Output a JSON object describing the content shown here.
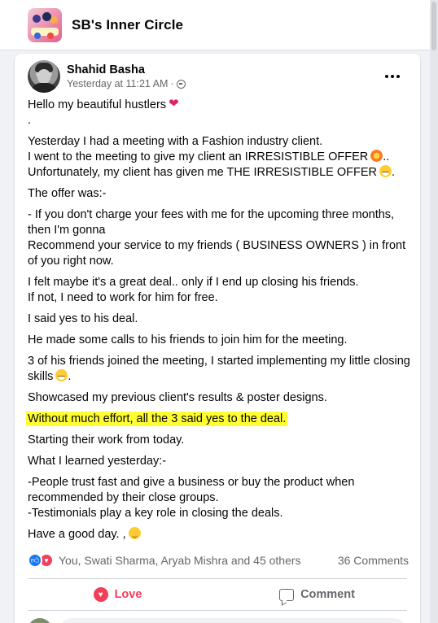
{
  "group": {
    "title": "SB's Inner Circle"
  },
  "post": {
    "author": "Shahid Basha",
    "time": "Yesterday at 11:21 AM",
    "time_sep": "·",
    "lines": [
      "Hello my beautiful hustlers",
      ".",
      "Yesterday I had a meeting with a Fashion industry client.",
      "I went to the meeting to give my client an IRRESISTIBLE OFFER",
      "..",
      "Unfortunately, my client has given me THE IRRESISTIBLE OFFER",
      ".",
      "The offer was:-",
      "- If you don't charge your fees with me for the upcoming three months, then I'm gonna",
      "Recommend your service to my friends ( BUSINESS OWNERS ) in front of you right now.",
      "I felt maybe it's a great deal.. only if I end up closing his friends.",
      "If not, I need to work for him for free.",
      "I said yes to his deal.",
      "He made some calls to his friends to join him for the meeting.",
      "3 of his friends joined the meeting, I started implementing my little closing skills",
      ".",
      "Showcased my previous client's results & poster designs.",
      "Without much effort, all the 3 said yes to the deal.",
      "Starting their work from today.",
      "What I learned yesterday:-",
      "-People trust fast and give a business or buy the product when recommended by their close groups.",
      "-Testimonials play a key role in closing the deals.",
      "Have a good day. ,"
    ],
    "reactions_text": "You, Swati Sharma, Aryab Mishra and 45 others",
    "comments_text": "36 Comments",
    "actions": {
      "love": "Love",
      "comment": "Comment"
    }
  },
  "colors": {
    "highlight": "#ffff33",
    "love": "#f33e58",
    "like": "#1877f2"
  }
}
